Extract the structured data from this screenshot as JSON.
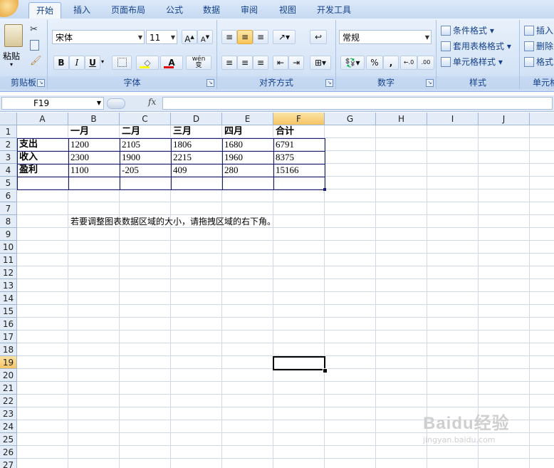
{
  "tabs": [
    {
      "label": "开始",
      "active": true
    },
    {
      "label": "插入"
    },
    {
      "label": "页面布局"
    },
    {
      "label": "公式"
    },
    {
      "label": "数据"
    },
    {
      "label": "审阅"
    },
    {
      "label": "视图"
    },
    {
      "label": "开发工具"
    }
  ],
  "ribbon": {
    "clipboard": {
      "label": "剪贴板",
      "paste": "粘贴"
    },
    "font": {
      "label": "字体",
      "name": "宋体",
      "size": "11",
      "bold": "B",
      "italic": "I",
      "underline": "U",
      "phonetic": "wén",
      "phonetic_char": "变"
    },
    "alignment": {
      "label": "对齐方式"
    },
    "number": {
      "label": "数字",
      "format": "常规",
      "percent": "%",
      "comma": ","
    },
    "styles": {
      "label": "样式",
      "conditional": "条件格式",
      "table": "套用表格格式",
      "cell": "单元格样式"
    },
    "cells": {
      "label": "单元格",
      "insert": "插入",
      "delete": "删除",
      "format": "格式"
    }
  },
  "formula_bar": {
    "name_box": "F19",
    "fx": "fx",
    "formula": ""
  },
  "columns": [
    "A",
    "B",
    "C",
    "D",
    "E",
    "F",
    "G",
    "H",
    "I",
    "J"
  ],
  "active_column": "F",
  "rows": [
    "1",
    "2",
    "3",
    "4",
    "5",
    "6",
    "7",
    "8",
    "9",
    "10",
    "11",
    "12",
    "13",
    "14",
    "15",
    "16",
    "17",
    "18",
    "19",
    "20",
    "21",
    "22",
    "23",
    "24",
    "25",
    "26",
    "27"
  ],
  "active_row": "19",
  "table": {
    "header": [
      "",
      "一月",
      "二月",
      "三月",
      "四月",
      "合计"
    ],
    "body": [
      [
        "支出",
        "1200",
        "2105",
        "1806",
        "1680",
        "6791"
      ],
      [
        "收入",
        "2300",
        "1900",
        "2215",
        "1960",
        "8375"
      ],
      [
        "盈利",
        "1100",
        "-205",
        "409",
        "280",
        "15166"
      ]
    ]
  },
  "hint": "若要调整图表数据区域的大小，请拖拽区域的右下角。",
  "watermark": {
    "brand": "Baidu经验",
    "url": "jingyan.baidu.com"
  }
}
